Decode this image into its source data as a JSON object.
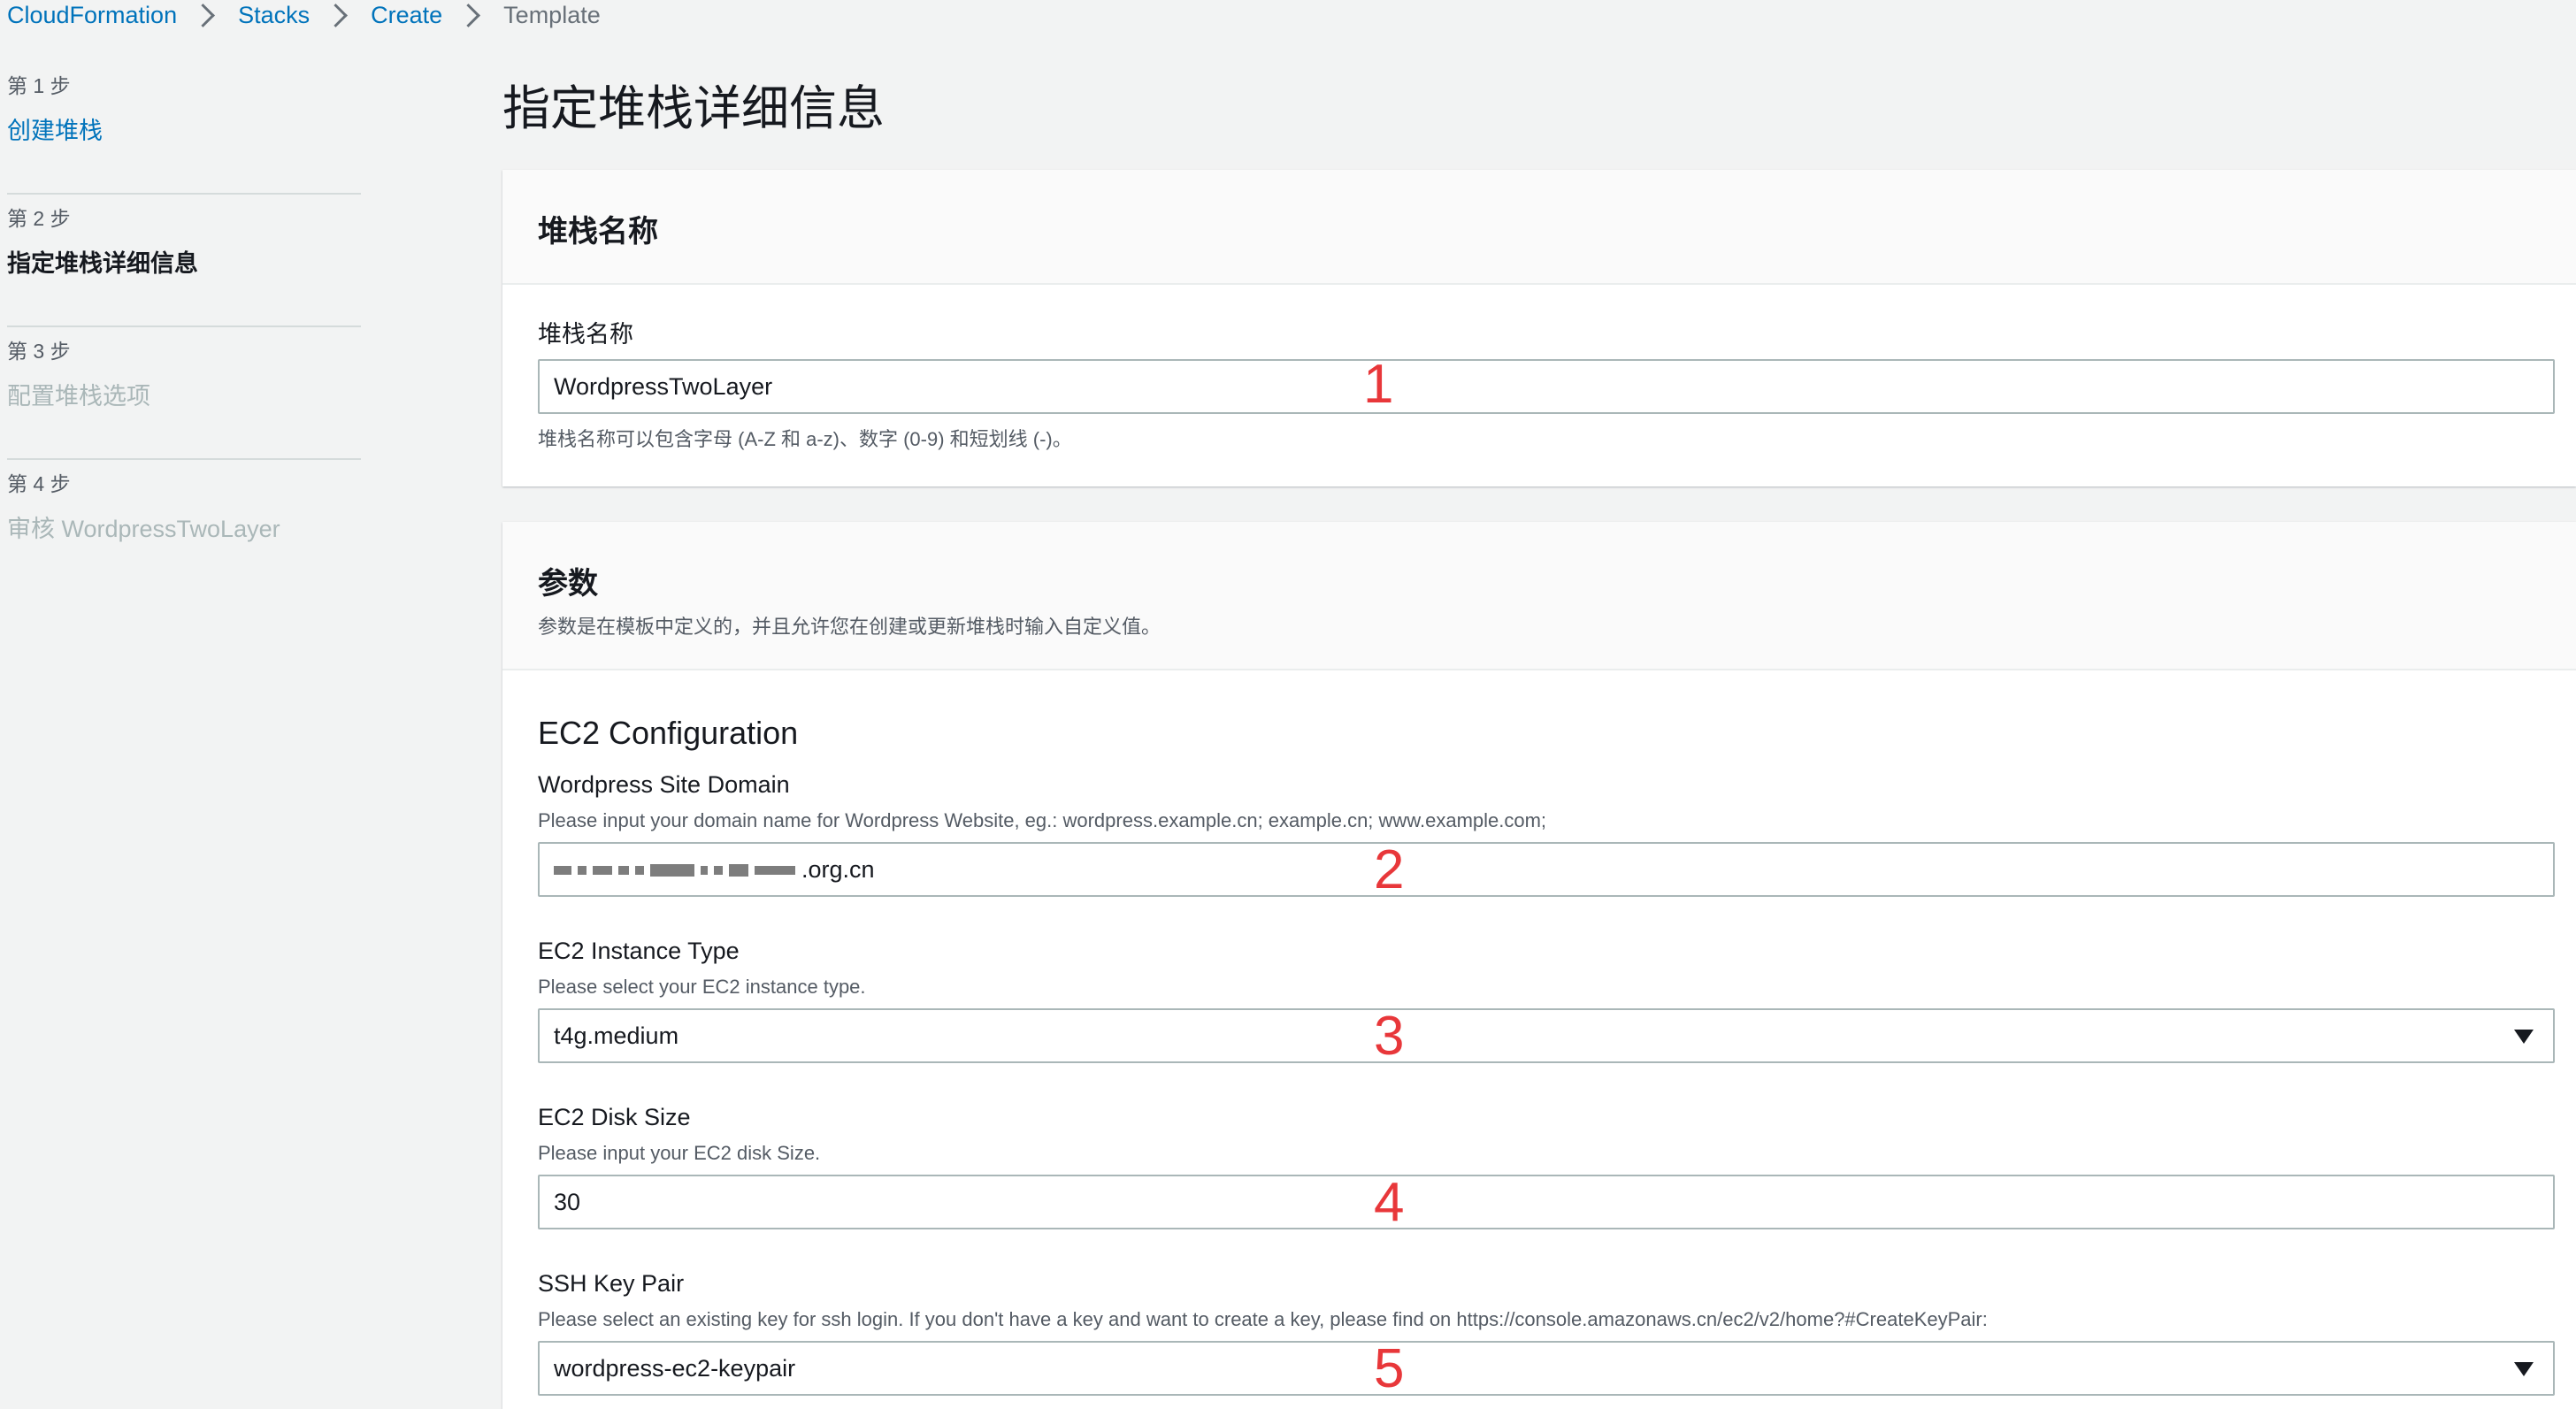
{
  "breadcrumb": {
    "items": [
      {
        "label": "CloudFormation"
      },
      {
        "label": "Stacks"
      },
      {
        "label": "Create"
      },
      {
        "label": "Template"
      }
    ]
  },
  "steps": [
    {
      "num": "第 1 步",
      "title": "创建堆栈",
      "state": "link"
    },
    {
      "num": "第 2 步",
      "title": "指定堆栈详细信息",
      "state": "active"
    },
    {
      "num": "第 3 步",
      "title": "配置堆栈选项",
      "state": "disabled"
    },
    {
      "num": "第 4 步",
      "title": "审核 WordpressTwoLayer",
      "state": "disabled"
    }
  ],
  "page": {
    "title": "指定堆栈详细信息"
  },
  "stack_name_panel": {
    "header": "堆栈名称",
    "label": "堆栈名称",
    "value": "WordpressTwoLayer",
    "hint": "堆栈名称可以包含字母 (A-Z 和 a-z)、数字 (0-9) 和短划线 (-)。"
  },
  "params_panel": {
    "header": "参数",
    "description": "参数是在模板中定义的，并且允许您在创建或更新堆栈时输入自定义值。",
    "section_title": "EC2 Configuration",
    "fields": {
      "domain": {
        "label": "Wordpress Site Domain",
        "desc": "Please input your domain name for Wordpress Website, eg.: wordpress.example.cn; example.cn; www.example.com;",
        "value_suffix": ".org.cn"
      },
      "instance_type": {
        "label": "EC2 Instance Type",
        "desc": "Please select your EC2 instance type.",
        "value": "t4g.medium"
      },
      "disk_size": {
        "label": "EC2 Disk Size",
        "desc": "Please input your EC2 disk Size.",
        "value": "30"
      },
      "key_pair": {
        "label": "SSH Key Pair",
        "desc": "Please select an existing key for ssh login. If you don't have a key and want to create a key, please find on https://console.amazonaws.cn/ec2/v2/home?#CreateKeyPair:",
        "value": "wordpress-ec2-keypair"
      }
    }
  },
  "annotations": [
    "1",
    "2",
    "3",
    "4",
    "5"
  ],
  "colors": {
    "link": "#0073bb",
    "annotation": "#e8373a",
    "background": "#f2f3f3"
  }
}
